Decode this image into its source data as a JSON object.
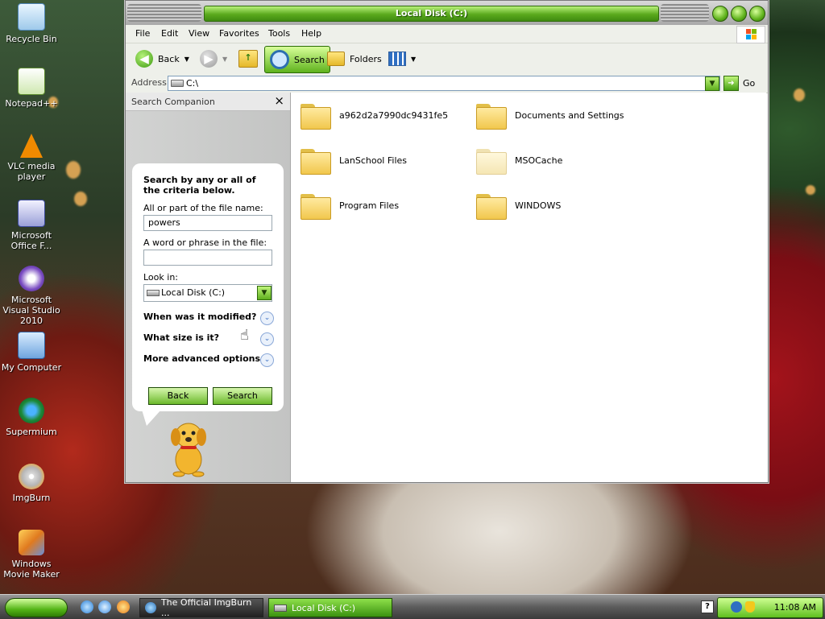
{
  "desktop": {
    "icons": [
      {
        "label": "Recycle Bin",
        "icon": "recycle-bin-icon"
      },
      {
        "label": "Notepad++",
        "icon": "notepad-plus-icon"
      },
      {
        "label": "VLC media player",
        "icon": "vlc-cone-icon"
      },
      {
        "label": "Microsoft Office F...",
        "icon": "office-shortcut-icon"
      },
      {
        "label": "Microsoft Visual Studio 2010",
        "icon": "visual-studio-icon"
      },
      {
        "label": "My Computer",
        "icon": "my-computer-icon"
      },
      {
        "label": "Supermium",
        "icon": "supermium-icon"
      },
      {
        "label": "ImgBurn",
        "icon": "imgburn-disc-icon"
      },
      {
        "label": "Windows Movie Maker",
        "icon": "movie-maker-icon"
      }
    ]
  },
  "window": {
    "title": "Local Disk (C:)",
    "menu": [
      "File",
      "Edit",
      "View",
      "Favorites",
      "Tools",
      "Help"
    ],
    "toolbar": {
      "back_label": "Back",
      "search_label": "Search",
      "folders_label": "Folders"
    },
    "address": {
      "label": "Address",
      "value": "C:\\",
      "go_label": "Go"
    }
  },
  "search_companion": {
    "header": "Search Companion",
    "close_glyph": "×",
    "intro": "Search by any or all of the criteria below.",
    "file_name_label": "All or part of the file name:",
    "file_name_value": "powers",
    "phrase_label": "A word or phrase in the file:",
    "phrase_value": "",
    "look_in_label": "Look in:",
    "look_in_value": "Local Disk (C:)",
    "options": [
      "When was it modified?",
      "What size is it?",
      "More advanced options"
    ],
    "back_button": "Back",
    "search_button": "Search"
  },
  "folders": [
    {
      "name": "a962d2a7990dc9431fe5",
      "dimmed": false
    },
    {
      "name": "Documents and Settings",
      "dimmed": false
    },
    {
      "name": "LanSchool Files",
      "dimmed": false
    },
    {
      "name": "MSOCache",
      "dimmed": true
    },
    {
      "name": "Program Files",
      "dimmed": false
    },
    {
      "name": "WINDOWS",
      "dimmed": false
    }
  ],
  "taskbar": {
    "tasks": [
      {
        "label": "The Official ImgBurn ...",
        "active": false
      },
      {
        "label": "Local Disk (C:)",
        "active": true
      }
    ],
    "clock": "11:08 AM",
    "help_glyph": "?"
  },
  "colors": {
    "accent_green": "#5aa91d",
    "title_text": "#ffffff",
    "folder_yellow": "#f1c74d"
  }
}
